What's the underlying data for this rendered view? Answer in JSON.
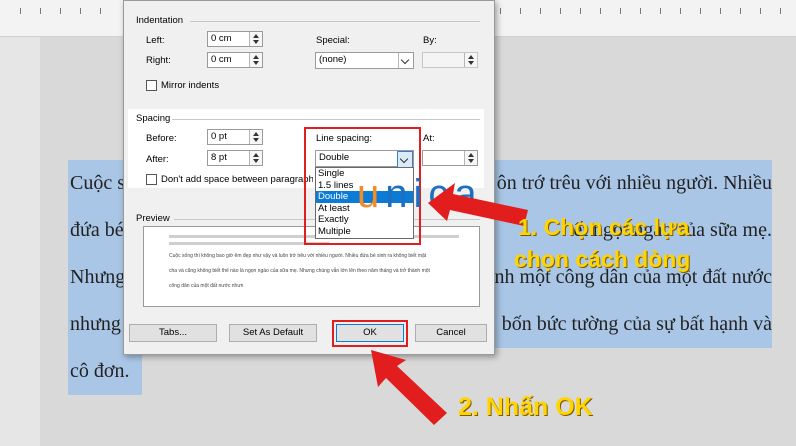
{
  "dialog": {
    "indentation": {
      "title": "Indentation",
      "left_label": "Left:",
      "left_value": "0 cm",
      "right_label": "Right:",
      "right_value": "0 cm",
      "special_label": "Special:",
      "special_value": "(none)",
      "by_label": "By:",
      "mirror_label": "Mirror indents"
    },
    "spacing": {
      "title": "Spacing",
      "before_label": "Before:",
      "before_value": "0 pt",
      "after_label": "After:",
      "after_value": "8 pt",
      "line_spacing_label": "Line spacing:",
      "line_spacing_value": "Double",
      "at_label": "At:",
      "dont_add_label": "Don't add space between paragraphs",
      "options": [
        "Single",
        "1.5 lines",
        "Double",
        "At least",
        "Exactly",
        "Multiple"
      ],
      "selected_index": 2
    },
    "preview": {
      "title": "Preview",
      "sample_text": [
        "Cuộc sống thì không bao giờ êm đẹp như vậy và luôn trớ trêu với nhiều người. Nhiều đứa bé sinh ra không biết mặt",
        "cha và cũng không biết thế nào là ngọn ngào của sữa mẹ. Nhưng chúng vẫn lớn lên theo năm tháng và trở thành một",
        "công dân của một đất nước nhưn"
      ]
    },
    "buttons": {
      "tabs": "Tabs...",
      "set_default": "Set As Default",
      "ok": "OK",
      "cancel": "Cancel"
    }
  },
  "document": {
    "lines": [
      {
        "left": "Cuộc s",
        "right": "ôn trớ trêu với nhiều người. Nhiều"
      },
      {
        "left": "đứa bé",
        "right": "ết ngọt ngào của sữa mẹ."
      },
      {
        "left": "Nhưng",
        "right": "hành một công dân của một đất nước"
      },
      {
        "left": "nhưng",
        "right": "bốn bức tường của sự bất hạnh và"
      },
      {
        "left": "cô đơn.",
        "right": ""
      }
    ]
  },
  "logo": {
    "letters": [
      "u",
      "n",
      "i",
      "c",
      "a"
    ],
    "colors": [
      "#f28c28",
      "#1f6fc1",
      "#1f6fc1",
      "#1f6fc1",
      "#1f6fc1"
    ]
  },
  "annotations": {
    "step1_line1": "1. Chọn các lựa",
    "step1_line2": "chọn cách dòng",
    "step2": "2. Nhấn OK",
    "color": "#ffd400",
    "arrow_color": "#e11d1d"
  }
}
